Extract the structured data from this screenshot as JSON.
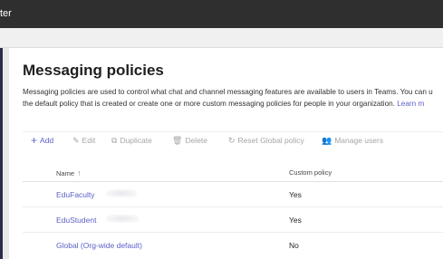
{
  "app": {
    "title_fragment": "ter"
  },
  "page": {
    "title": "Messaging policies",
    "description_line1": "Messaging policies are used to control what chat and channel messaging features are available to users in Teams. You can u",
    "description_line2": "the default policy that is created or create one or more custom messaging policies for people in your organization.",
    "learn_more": "Learn m"
  },
  "toolbar": {
    "add": {
      "label": "Add",
      "icon": "plus-icon"
    },
    "edit": {
      "label": "Edit",
      "icon": "pencil-icon"
    },
    "duplicate": {
      "label": "Duplicate",
      "icon": "copy-icon"
    },
    "delete": {
      "label": "Delete",
      "icon": "trash-icon"
    },
    "reset": {
      "label": "Reset Global policy",
      "icon": "reset-icon"
    },
    "manage_users": {
      "label": "Manage users",
      "icon": "people-icon"
    }
  },
  "table": {
    "columns": {
      "name": "Name",
      "custom": "Custom policy"
    },
    "rows": [
      {
        "name": "EduFaculty",
        "custom": "Yes"
      },
      {
        "name": "EduStudent",
        "custom": "Yes"
      },
      {
        "name": "Global (Org-wide default)",
        "custom": "No"
      }
    ]
  },
  "colors": {
    "topbar": "#2f2f2f",
    "accent": "#5b5fc7",
    "disabled": "#a6a6a6"
  }
}
